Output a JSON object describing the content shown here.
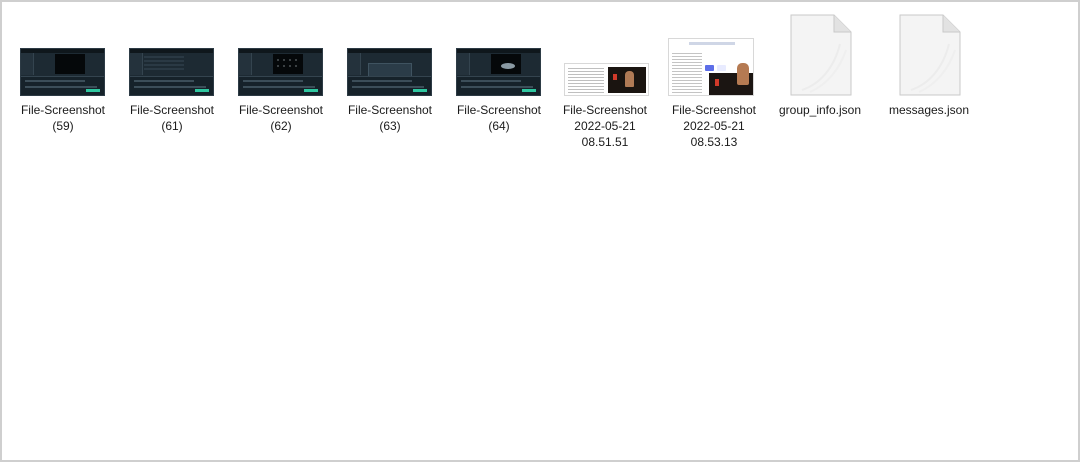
{
  "files": [
    {
      "name": "File-Screenshot\n(59)",
      "kind": "image",
      "thumb": "editor-dark"
    },
    {
      "name": "File-Screenshot\n(61)",
      "kind": "image",
      "thumb": "editor-dark-list"
    },
    {
      "name": "File-Screenshot\n(62)",
      "kind": "image",
      "thumb": "editor-dark-dots"
    },
    {
      "name": "File-Screenshot\n(63)",
      "kind": "image",
      "thumb": "editor-dark-menu"
    },
    {
      "name": "File-Screenshot\n(64)",
      "kind": "image",
      "thumb": "editor-dark-blob"
    },
    {
      "name": "File-Screenshot\n2022-05-21\n08.51.51",
      "kind": "image",
      "thumb": "webpage-video"
    },
    {
      "name": "File-Screenshot\n2022-05-21\n08.53.13",
      "kind": "image",
      "thumb": "webpage-chat-video"
    },
    {
      "name": "group_info.json",
      "kind": "document",
      "icon": "document-icon"
    },
    {
      "name": "messages.json",
      "kind": "document",
      "icon": "document-icon"
    }
  ],
  "colors": {
    "window_border": "#cfcfcf",
    "background": "#ffffff",
    "label_text": "#1a1a1a"
  }
}
